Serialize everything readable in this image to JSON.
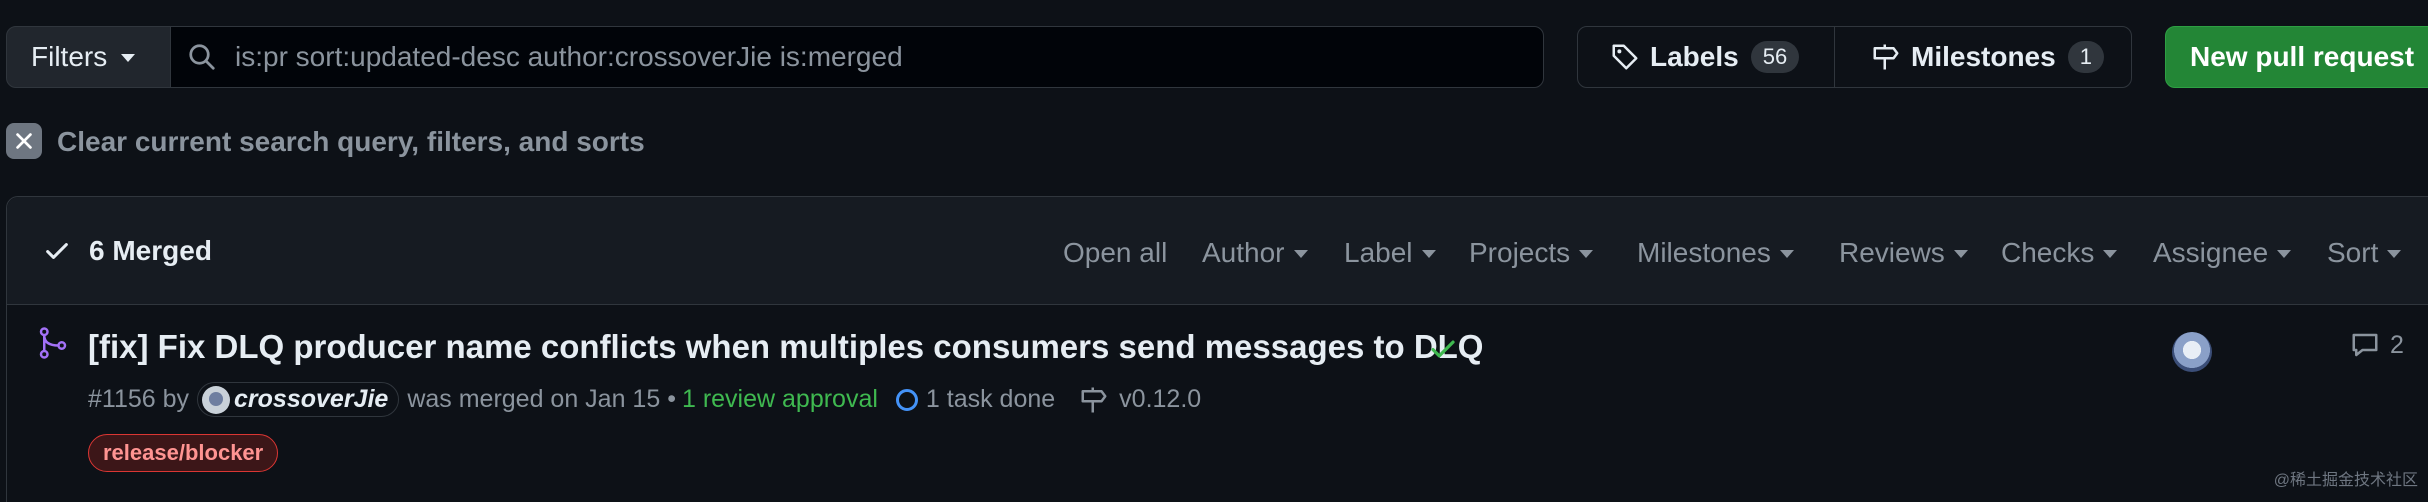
{
  "toolbar": {
    "filters_label": "Filters",
    "search_value": "is:pr sort:updated-desc author:crossoverJie is:merged",
    "labels_label": "Labels",
    "labels_count": "56",
    "milestones_label": "Milestones",
    "milestones_count": "1",
    "new_pr_label": "New pull request"
  },
  "clear": {
    "label": "Clear current search query, filters, and sorts"
  },
  "list_header": {
    "summary": "6 Merged",
    "open_all": "Open all",
    "filters": [
      "Author",
      "Label",
      "Projects",
      "Milestones",
      "Reviews",
      "Checks",
      "Assignee",
      "Sort"
    ]
  },
  "pr": {
    "title": "[fix] Fix DLQ producer name conflicts when multiples consumers send messages to DLQ",
    "number": "#1156",
    "by": "by",
    "author": "crossoverJie",
    "merged_text": "was merged on Jan 15",
    "bullet": "•",
    "approval": "1 review approval",
    "task": "1 task done",
    "milestone": "v0.12.0",
    "label": "release/blocker",
    "comments": "2"
  },
  "watermark": "@稀土掘金技术社区",
  "colors": {
    "merged_purple": "#a371f7",
    "success_green": "#3fb950",
    "accent_blue": "#4493f8",
    "button_green": "#238636"
  }
}
